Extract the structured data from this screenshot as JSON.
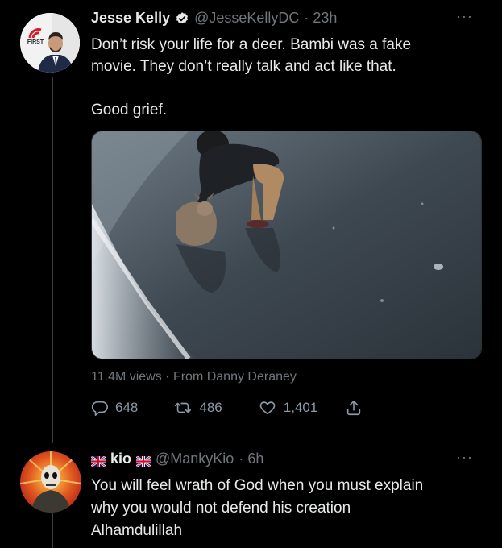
{
  "tweet": {
    "display_name": "Jesse Kelly",
    "handle": "@JesseKellyDC",
    "time": "· 23h",
    "text": "Don’t risk your life for a deer. Bambi was a fake\nmovie. They don’t really talk and act like that.\n\nGood grief.",
    "views_line": "11.4M views · From Danny Deraney",
    "replies": "648",
    "retweets": "486",
    "likes": "1,401",
    "more": "···",
    "avatar_badge": "FIRST"
  },
  "reply": {
    "display_name": "kio",
    "handle": "@MankyKio",
    "time": "· 6h",
    "text": "You will feel wrath of God when you must explain\nwhy you would not defend his creation\nAlhamdulillah",
    "more": "···"
  },
  "colors": {
    "background": "#000000",
    "text": "#e7e9ea",
    "muted": "#71767b",
    "verified": "#e7e9ea"
  }
}
